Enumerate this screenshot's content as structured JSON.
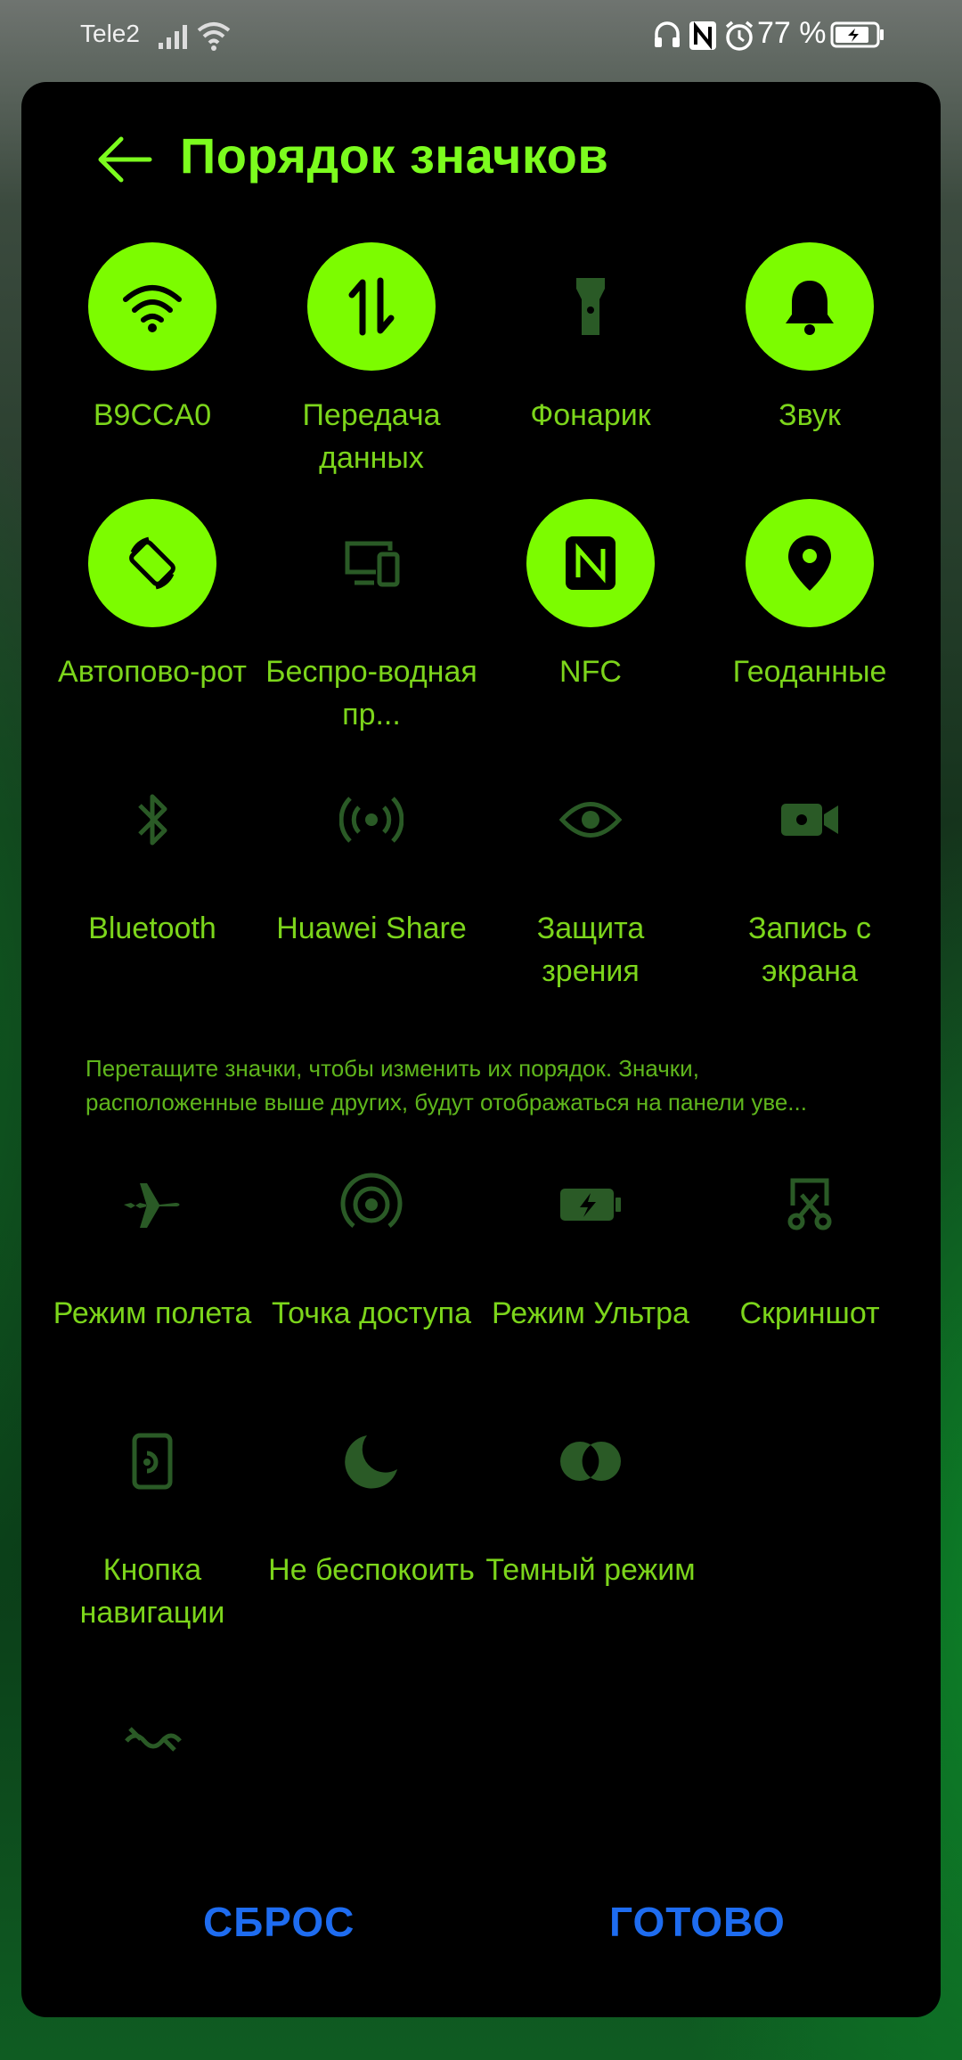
{
  "status_bar": {
    "carrier": "Tele2",
    "battery_percent": "77 %"
  },
  "header": {
    "title": "Порядок значков"
  },
  "active_tiles": [
    {
      "label": "B9CCA0",
      "icon": "wifi-icon",
      "enabled": true
    },
    {
      "label": "Передача данных",
      "icon": "data-transfer-icon",
      "enabled": true
    },
    {
      "label": "Фонарик",
      "icon": "flashlight-icon",
      "enabled": false
    },
    {
      "label": "Звук",
      "icon": "bell-icon",
      "enabled": true
    },
    {
      "label": "Автопово-рот",
      "icon": "auto-rotate-icon",
      "enabled": true
    },
    {
      "label": "Беспро-водная пр...",
      "icon": "wireless-projection-icon",
      "enabled": false
    },
    {
      "label": "NFC",
      "icon": "nfc-icon",
      "enabled": true
    },
    {
      "label": "Геоданные",
      "icon": "location-icon",
      "enabled": true
    },
    {
      "label": "Bluetooth",
      "icon": "bluetooth-icon",
      "enabled": false
    },
    {
      "label": "Huawei Share",
      "icon": "huawei-share-icon",
      "enabled": false
    },
    {
      "label": "Защита зрения",
      "icon": "eye-icon",
      "enabled": false
    },
    {
      "label": "Запись с экрана",
      "icon": "screen-record-icon",
      "enabled": false
    }
  ],
  "hint": "Перетащите значки, чтобы изменить их порядок. Значки, расположенные выше других, будут отображаться на панели уве...",
  "inactive_tiles": [
    {
      "label": "Режим полета",
      "icon": "airplane-icon"
    },
    {
      "label": "Точка доступа",
      "icon": "hotspot-icon"
    },
    {
      "label": "Режим Ультра",
      "icon": "battery-ultra-icon"
    },
    {
      "label": "Скриншот",
      "icon": "screenshot-icon"
    },
    {
      "label": "Кнопка навигации",
      "icon": "nav-button-icon"
    },
    {
      "label": "Не беспокоить",
      "icon": "moon-icon"
    },
    {
      "label": "Темный режим",
      "icon": "dark-mode-icon"
    },
    {
      "label": "",
      "icon": "wave-icon"
    }
  ],
  "actions": {
    "reset": "СБРОС",
    "done": "ГОТОВО"
  },
  "colors": {
    "accent": "#7cfc00",
    "label": "#7cd51b",
    "inactive_icon": "#2e6b2a",
    "button": "#1e6cf0"
  }
}
